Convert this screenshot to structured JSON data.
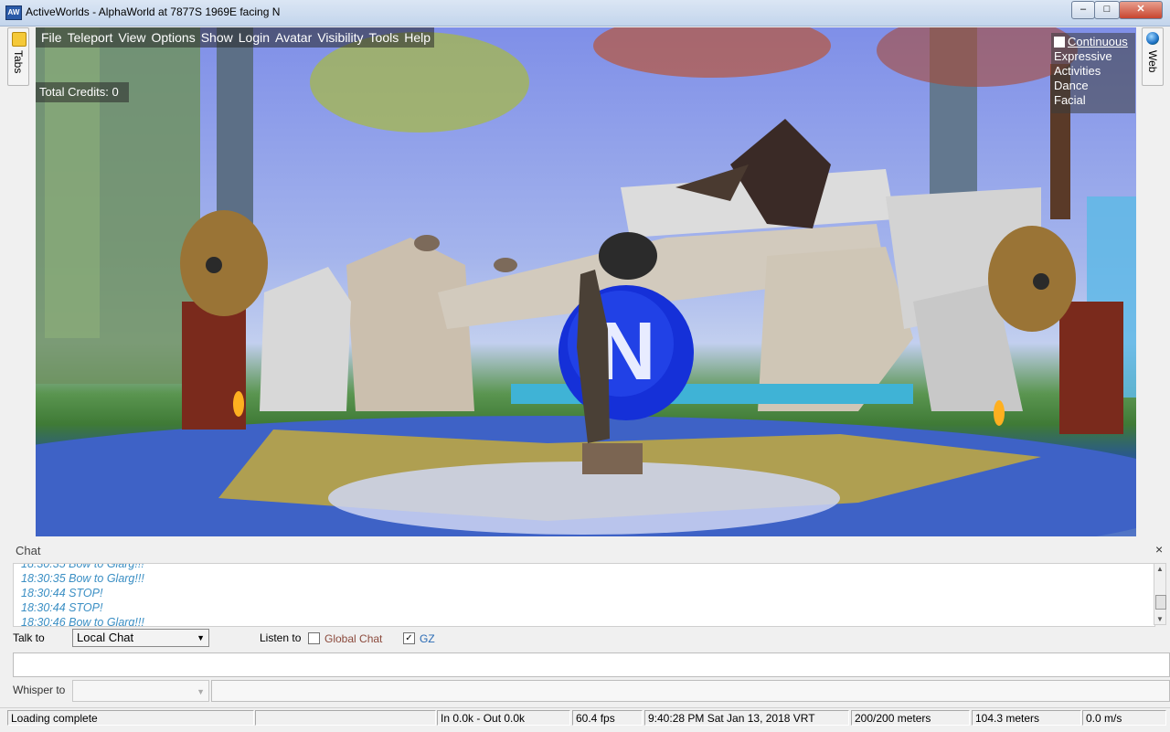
{
  "window": {
    "title": "ActiveWorlds - AlphaWorld at 7877S 1969E facing N",
    "app_icon_text": "AW"
  },
  "side_tabs": {
    "left": "Tabs",
    "right": "Web"
  },
  "menu": [
    "File",
    "Teleport",
    "View",
    "Options",
    "Show",
    "Login",
    "Avatar",
    "Visibility",
    "Tools",
    "Help"
  ],
  "credits": "Total Credits: 0",
  "gestures": {
    "continuous_label": "Continuous",
    "continuous_checked": false,
    "items": [
      "Expressive",
      "Activities",
      "Dance",
      "Facial"
    ]
  },
  "scene": {
    "sign_letter": "N"
  },
  "chat": {
    "title": "Chat",
    "close": "×",
    "lines": [
      "18:30:35 Bow to Glarg!!!",
      "18:30:35 Bow to Glarg!!!",
      "18:30:44 STOP!",
      "18:30:44 STOP!",
      "18:30:46 Bow to Glarg!!!"
    ],
    "talk_label": "Talk to",
    "talk_value": "Local Chat",
    "listen_label": "Listen to",
    "global_chat_label": "Global Chat",
    "global_chat_checked": false,
    "gz_label": "GZ",
    "gz_checked": true,
    "whisper_label": "Whisper to",
    "whisper_value": ""
  },
  "status": {
    "message": "Loading complete",
    "traffic": "In  0.0k - Out  0.0k",
    "fps": "60.4 fps",
    "datetime": "9:40:28 PM Sat Jan 13, 2018 VRT",
    "visibility": "200/200 meters",
    "distance": "104.3 meters",
    "speed": "0.0 m/s"
  },
  "colors": {
    "chat_text": "#3b8fc4",
    "global_chat": "#8b4a3c",
    "gz": "#2a6bb5"
  }
}
